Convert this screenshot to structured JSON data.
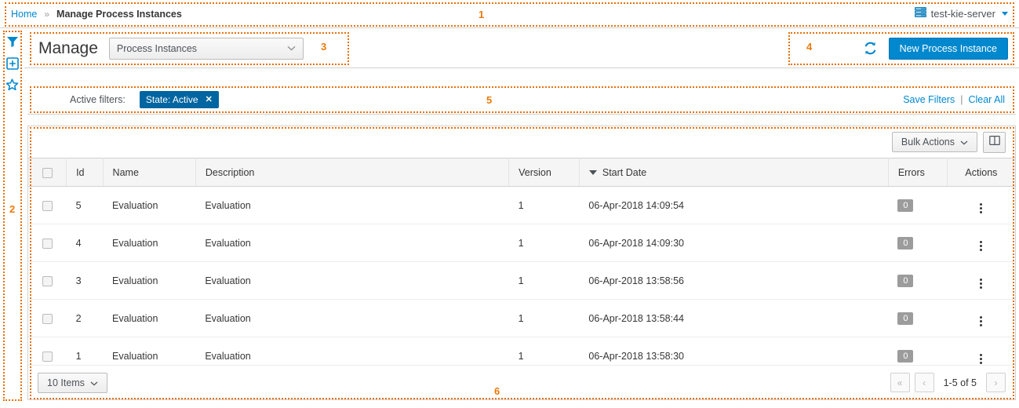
{
  "breadcrumb": {
    "home_label": "Home",
    "separator": "»",
    "current_label": "Manage Process Instances"
  },
  "server_selector": {
    "icon": "server-stack-icon",
    "label": "test-kie-server"
  },
  "sidebar": {
    "items": [
      {
        "icon": "filter-funnel-icon",
        "name": "filters-panel-toggle"
      },
      {
        "icon": "add-box-icon",
        "name": "add-panel-toggle"
      },
      {
        "icon": "star-outline-icon",
        "name": "favorites-panel-toggle"
      }
    ]
  },
  "toolbar": {
    "title": "Manage",
    "selected_view": "Process Instances",
    "refresh_icon": "refresh-icon",
    "new_instance_label": "New Process Instance"
  },
  "filters": {
    "active_label": "Active filters:",
    "chips": [
      {
        "label": "State: Active",
        "remove_icon": "close-icon"
      }
    ],
    "save_label": "Save Filters",
    "divider": "|",
    "clear_label": "Clear All"
  },
  "table_actions": {
    "bulk_label": "Bulk Actions",
    "bulk_caret": "⌄",
    "columns_icon": "columns-toggle-icon"
  },
  "table": {
    "columns": [
      {
        "key": "check",
        "label": "",
        "sorted": false
      },
      {
        "key": "id",
        "label": "Id",
        "sorted": false
      },
      {
        "key": "name",
        "label": "Name",
        "sorted": false
      },
      {
        "key": "desc",
        "label": "Description",
        "sorted": false
      },
      {
        "key": "version",
        "label": "Version",
        "sorted": false
      },
      {
        "key": "start",
        "label": "Start Date",
        "sorted": true,
        "sort_dir": "desc"
      },
      {
        "key": "errors",
        "label": "Errors",
        "sorted": false
      },
      {
        "key": "actions",
        "label": "Actions",
        "sorted": false
      }
    ],
    "rows": [
      {
        "id": "5",
        "name": "Evaluation",
        "desc": "Evaluation",
        "version": "1",
        "start": "06-Apr-2018 14:09:54",
        "errors": "0"
      },
      {
        "id": "4",
        "name": "Evaluation",
        "desc": "Evaluation",
        "version": "1",
        "start": "06-Apr-2018 14:09:30",
        "errors": "0"
      },
      {
        "id": "3",
        "name": "Evaluation",
        "desc": "Evaluation",
        "version": "1",
        "start": "06-Apr-2018 13:58:56",
        "errors": "0"
      },
      {
        "id": "2",
        "name": "Evaluation",
        "desc": "Evaluation",
        "version": "1",
        "start": "06-Apr-2018 13:58:44",
        "errors": "0"
      },
      {
        "id": "1",
        "name": "Evaluation",
        "desc": "Evaluation",
        "version": "1",
        "start": "06-Apr-2018 13:58:30",
        "errors": "0"
      }
    ]
  },
  "footer": {
    "page_size_label": "10 Items",
    "first_label": "«",
    "prev_label": "‹",
    "range_label": "1-5 of 5",
    "next_label": "›"
  },
  "annotations": [
    {
      "num": "1"
    },
    {
      "num": "2"
    },
    {
      "num": "3"
    },
    {
      "num": "4"
    },
    {
      "num": "5"
    },
    {
      "num": "6"
    }
  ],
  "colors": {
    "accent_blue": "#0088ce",
    "chip_blue": "#0065a0",
    "annotation_orange": "#ec7a08",
    "badge_gray": "#9c9c9c"
  }
}
